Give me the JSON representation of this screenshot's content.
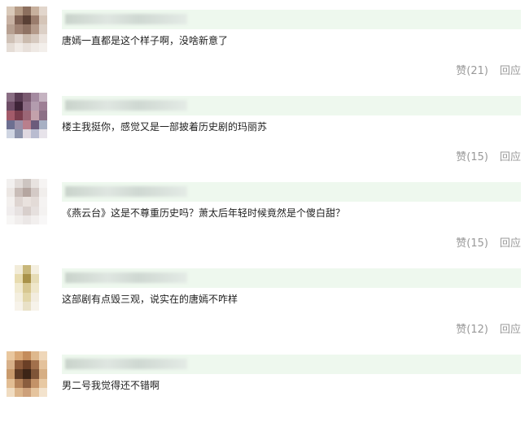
{
  "comments": [
    {
      "text": "唐嫣一直都是这个样子啊，没啥新意了",
      "like_label": "赞(21)",
      "reply_label": "回应",
      "avatar_colors": [
        "#d9c9b9",
        "#b59b86",
        "#8c6f5e",
        "#c7b09d",
        "#e2d6cc",
        "#c8b2a3",
        "#7d5f52",
        "#5a4035",
        "#9a7c6c",
        "#d5c5b8",
        "#b7a091",
        "#a08374",
        "#8f7263",
        "#b49a8a",
        "#dcd0c6",
        "#cfc1b6",
        "#e0d5cd",
        "#cbbbae",
        "#d6c9bf",
        "#ebe3dd",
        "#e5ddd6",
        "#f0eae5",
        "#e8e0da",
        "#efe9e4",
        "#f3efeb"
      ]
    },
    {
      "text": "楼主我挺你，感觉又是一部披着历史剧的玛丽苏",
      "like_label": "赞(15)",
      "reply_label": "回应",
      "avatar_colors": [
        "#8a6e84",
        "#5b3d55",
        "#7a5a70",
        "#a48aa0",
        "#c5b3c1",
        "#6e4d66",
        "#3e2438",
        "#8c6c84",
        "#b39cae",
        "#9e7f95",
        "#a35b6a",
        "#7b3e4e",
        "#9b6676",
        "#c3a1ab",
        "#8c7086",
        "#6d6f91",
        "#9a8fa8",
        "#b97f8c",
        "#6b5b7b",
        "#a7b0c4",
        "#cfd5e2",
        "#8d94ac",
        "#dfd8e0",
        "#b9bcd0",
        "#e7e3ea"
      ]
    },
    {
      "text": "《燕云台》这是不尊重历史吗？萧太后年轻时候竟然是个傻白甜？",
      "like_label": "赞(15)",
      "reply_label": "回应",
      "avatar_colors": [
        "#f2f0ef",
        "#e2dcd9",
        "#cdc5c1",
        "#e8e3e0",
        "#f6f4f3",
        "#ece7e4",
        "#c9bdb8",
        "#b5a6a0",
        "#d4cac6",
        "#f1eeec",
        "#f3f0ee",
        "#ded5d1",
        "#e9e2de",
        "#e3dbd7",
        "#f5f3f2",
        "#f0eded",
        "#e7e2e1",
        "#d8cfcc",
        "#e6e0de",
        "#f4f2f1",
        "#f7f6f5",
        "#f1eeed",
        "#ebe7e6",
        "#f2efee",
        "#f8f7f7"
      ]
    },
    {
      "text": "这部剧有点毁三观，说实在的唐嫣不咋样",
      "like_label": "赞(12)",
      "reply_label": "回应",
      "avatar_colors": [
        "#ffffff",
        "#f2ecd9",
        "#c8b77a",
        "#f4efe0",
        "#ffffff",
        "#ffffff",
        "#e8dcb0",
        "#a99249",
        "#e6dcb6",
        "#ffffff",
        "#ffffff",
        "#f1ead0",
        "#d7c791",
        "#efe7cb",
        "#ffffff",
        "#ffffff",
        "#f4efe0",
        "#e2d6a9",
        "#f3ede0",
        "#ffffff",
        "#ffffff",
        "#f7f3ea",
        "#e9e1c7",
        "#f7f3ea",
        "#ffffff"
      ]
    },
    {
      "text": "男二号我觉得还不错啊",
      "like_label": "",
      "reply_label": "",
      "avatar_colors": [
        "#e9c79e",
        "#d9a876",
        "#c48c5b",
        "#deb88d",
        "#efd7b9",
        "#d7b089",
        "#8c5a3a",
        "#6b3f26",
        "#a2704c",
        "#e4c29c",
        "#c99a6c",
        "#5e3a24",
        "#3c2416",
        "#7f5538",
        "#d6ae84",
        "#e2bd93",
        "#b5835a",
        "#8a5d3e",
        "#c39268",
        "#e8c9a3",
        "#f0dcc1",
        "#dcb58b",
        "#cda07a",
        "#e5c49e",
        "#f3e3cd"
      ]
    }
  ]
}
